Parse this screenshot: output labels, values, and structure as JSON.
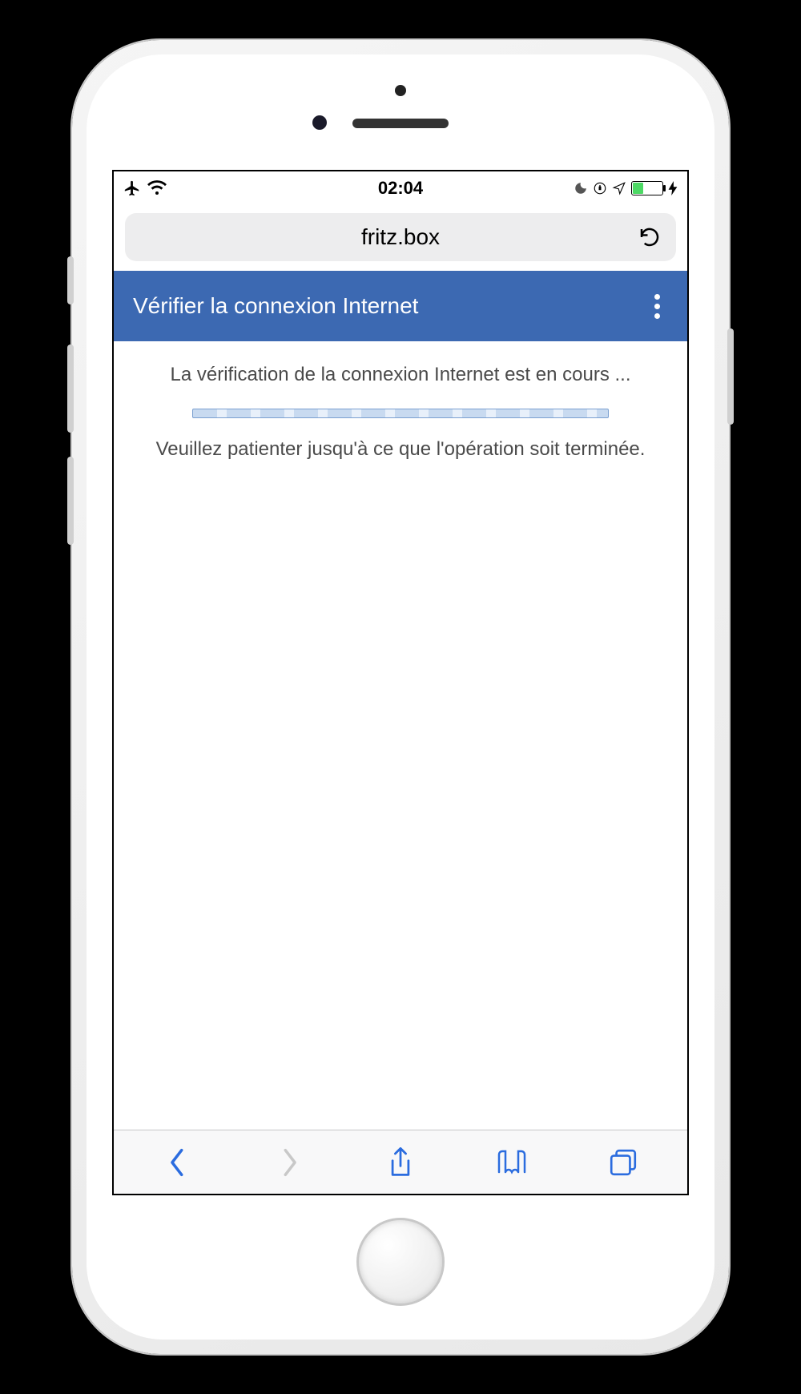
{
  "status_bar": {
    "time": "02:04",
    "icons": {
      "airplane": "airplane-icon",
      "wifi": "wifi-icon",
      "moon": "do-not-disturb-icon",
      "lock_rotation": "orientation-lock-icon",
      "location": "location-icon",
      "battery": "battery-icon",
      "charging": "charging-icon"
    }
  },
  "browser": {
    "address": "fritz.box",
    "reload": "reload-icon"
  },
  "app": {
    "title": "Vérifier la connexion Internet",
    "menu": "more-options"
  },
  "content": {
    "status": "La vérification de la connexion Internet est en cours ...",
    "wait": "Veuillez patienter jusqu'à ce que l'opération soit terminée."
  },
  "toolbar": {
    "back": "back-icon",
    "forward": "forward-icon",
    "share": "share-icon",
    "bookmarks": "bookmarks-icon",
    "tabs": "tabs-icon"
  },
  "colors": {
    "header_bg": "#3c69b2",
    "toolbar_icon": "#2b6cdf",
    "disabled_icon": "#c8c8c8",
    "battery_fill": "#4cd964"
  }
}
